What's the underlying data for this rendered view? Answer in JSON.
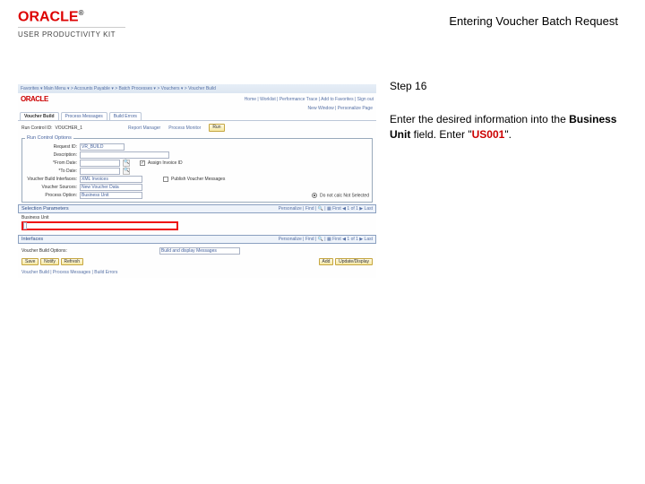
{
  "header": {
    "logo": "ORACLE",
    "upk": "USER PRODUCTIVITY KIT",
    "title": "Entering Voucher Batch Request"
  },
  "right": {
    "step": "Step 16",
    "instr1": "Enter the desired information into the ",
    "bold1": "Business Unit",
    "instr2": " field. Enter \"",
    "red1": "US001",
    "instr3": "\"."
  },
  "shot": {
    "breadcrumb": "Favorites ▾  Main Menu ▾  > Accounts Payable ▾  > Batch Processes ▾  > Vouchers ▾  > Voucher Build",
    "breadcrumb_right": "",
    "rbar_links": "Home  |  Worklist  |  Performance Trace  |  Add to Favorites  |  Sign out",
    "newwin": "New Window | Personalize Page",
    "tabs": [
      "Voucher Build",
      "Process Messages",
      "Build Errors"
    ],
    "rc_label": "Run Control ID:",
    "rc_val": "VOUCHER_1",
    "rm_label": "Report Manager",
    "pm_label": "Process Monitor",
    "run_btn": "Run",
    "opt_legend": "Run Control Options",
    "rows": {
      "request_id": "Request ID:",
      "request_id_v": "VR_BUILD",
      "description": "Description:",
      "description_v": "",
      "from_date": "*From Date:",
      "to_date": "*To Date:",
      "assign_inv": "Assign Invoice ID",
      "vb_interfaces": "Voucher Build Interfaces:",
      "vb_interfaces_v": "XML Invoices",
      "pub_vm": "Publish Voucher Messages",
      "voucher_sources": "Voucher Sources:",
      "voucher_sources_v": "New Voucher Data",
      "process_option": "Process Option:",
      "process_option_v": "Business Unit",
      "calc_not_sel": "Do not calc Not Selected"
    },
    "sel_params": "Selection Parameters",
    "sel_nav": "Personalize | Find | 🔍 | ▦   First ◀ 1 of 1 ▶ Last",
    "bu_label": "Business Unit",
    "interfaces_hdr": "Interfaces",
    "int_nav": "Personalize | Find | 🔍 | ▦   First ◀ 1 of 1 ▶ Last",
    "vbuild_opt": "Voucher Build Options:",
    "vbuild_opt_v": "Build and display Messages",
    "btn_save": "Save",
    "btn_notify": "Notify",
    "btn_refresh": "Refresh",
    "btn_add": "Add",
    "btn_update": "Update/Display",
    "footer_tabs": "Voucher Build | Process Messages | Build Errors"
  }
}
